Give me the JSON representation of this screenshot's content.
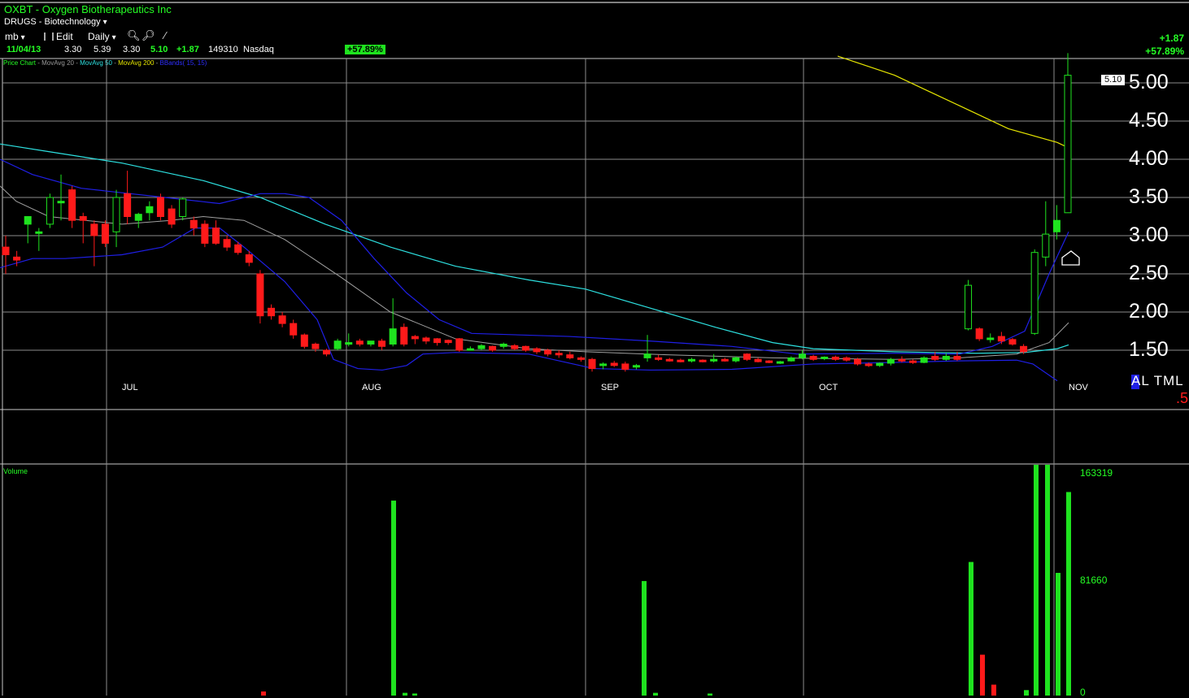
{
  "header": {
    "symbol_title": "OXBT - Oxygen Biotherapeutics Inc",
    "group": "DRUGS - Biotechnology",
    "menu": {
      "list": "mb",
      "edit": "Edit",
      "period": "Daily"
    }
  },
  "quote": {
    "date": "11/04/13",
    "open": "3.30",
    "high": "5.39",
    "low": "3.30",
    "close": "5.10",
    "change": "+1.87",
    "volume": "149310",
    "exchange": "Nasdaq",
    "pct_badge": "+57.89%"
  },
  "right_change": {
    "change": "+1.87",
    "pct": "+57.89%"
  },
  "legend": {
    "price": "Price Chart",
    "ma20": "MovAvg 20",
    "ma50": "MovAvg 50",
    "ma200": "MovAvg 200",
    "bb": "BBands( 15, 15)"
  },
  "price_tag": "5.10",
  "alert_text": "AL TML",
  "red_value": ".5",
  "volume_pane": {
    "label": "Volume",
    "ticks": [
      "163319",
      "81660",
      "0"
    ]
  },
  "colors": {
    "up": "#1fe31f",
    "down": "#ff1a1a",
    "ma20": "#a0a0a0",
    "ma50": "#2de0e0",
    "ma200": "#e6e600",
    "bb": "#1f1fe6"
  },
  "chart_data": {
    "type": "candlestick",
    "y_ticks": [
      "5.00",
      "4.50",
      "4.00",
      "3.50",
      "3.00",
      "2.50",
      "2.00",
      "1.50"
    ],
    "ylim": [
      1.15,
      5.35
    ],
    "x_months": [
      "JUL",
      "AUG",
      "SEP",
      "OCT",
      "NOV"
    ],
    "candles": [
      {
        "o": 2.85,
        "h": 3.0,
        "l": 2.5,
        "c": 2.75
      },
      {
        "o": 2.72,
        "h": 2.8,
        "l": 2.6,
        "c": 2.68
      },
      {
        "o": 3.15,
        "h": 3.2,
        "l": 2.9,
        "c": 3.25
      },
      {
        "o": 3.05,
        "h": 3.1,
        "l": 2.8,
        "c": 3.05
      },
      {
        "o": 3.15,
        "h": 3.55,
        "l": 3.1,
        "c": 3.5
      },
      {
        "o": 3.45,
        "h": 3.8,
        "l": 3.2,
        "c": 3.45
      },
      {
        "o": 3.6,
        "h": 3.65,
        "l": 3.1,
        "c": 3.2
      },
      {
        "o": 3.25,
        "h": 3.3,
        "l": 2.9,
        "c": 3.2
      },
      {
        "o": 3.15,
        "h": 3.2,
        "l": 2.6,
        "c": 3.0
      },
      {
        "o": 3.15,
        "h": 3.2,
        "l": 2.85,
        "c": 2.9
      },
      {
        "o": 3.05,
        "h": 3.6,
        "l": 2.85,
        "c": 3.5
      },
      {
        "o": 3.55,
        "h": 3.85,
        "l": 3.15,
        "c": 3.25
      },
      {
        "o": 3.2,
        "h": 3.3,
        "l": 3.1,
        "c": 3.28
      },
      {
        "o": 3.3,
        "h": 3.45,
        "l": 3.2,
        "c": 3.38
      },
      {
        "o": 3.5,
        "h": 3.55,
        "l": 3.2,
        "c": 3.25
      },
      {
        "o": 3.35,
        "h": 3.4,
        "l": 3.1,
        "c": 3.15
      },
      {
        "o": 3.25,
        "h": 3.5,
        "l": 3.2,
        "c": 3.48
      },
      {
        "o": 3.2,
        "h": 3.25,
        "l": 3.0,
        "c": 3.1
      },
      {
        "o": 3.15,
        "h": 3.2,
        "l": 2.85,
        "c": 2.9
      },
      {
        "o": 3.1,
        "h": 3.2,
        "l": 2.88,
        "c": 2.9
      },
      {
        "o": 2.95,
        "h": 3.0,
        "l": 2.8,
        "c": 2.85
      },
      {
        "o": 2.88,
        "h": 2.92,
        "l": 2.75,
        "c": 2.78
      },
      {
        "o": 2.75,
        "h": 2.8,
        "l": 2.6,
        "c": 2.65
      },
      {
        "o": 2.5,
        "h": 2.55,
        "l": 1.85,
        "c": 1.95
      },
      {
        "o": 2.05,
        "h": 2.1,
        "l": 1.9,
        "c": 1.95
      },
      {
        "o": 1.95,
        "h": 2.0,
        "l": 1.8,
        "c": 1.85
      },
      {
        "o": 1.85,
        "h": 1.9,
        "l": 1.65,
        "c": 1.7
      },
      {
        "o": 1.7,
        "h": 1.72,
        "l": 1.52,
        "c": 1.55
      },
      {
        "o": 1.58,
        "h": 1.6,
        "l": 1.48,
        "c": 1.52
      },
      {
        "o": 1.5,
        "h": 1.52,
        "l": 1.42,
        "c": 1.45
      },
      {
        "o": 1.52,
        "h": 1.65,
        "l": 1.5,
        "c": 1.62
      },
      {
        "o": 1.58,
        "h": 1.72,
        "l": 1.55,
        "c": 1.6
      },
      {
        "o": 1.62,
        "h": 1.65,
        "l": 1.55,
        "c": 1.58
      },
      {
        "o": 1.58,
        "h": 1.62,
        "l": 1.55,
        "c": 1.62
      },
      {
        "o": 1.62,
        "h": 1.65,
        "l": 1.5,
        "c": 1.55
      },
      {
        "o": 1.58,
        "h": 2.18,
        "l": 1.55,
        "c": 1.78
      },
      {
        "o": 1.8,
        "h": 1.85,
        "l": 1.55,
        "c": 1.58
      },
      {
        "o": 1.68,
        "h": 1.7,
        "l": 1.58,
        "c": 1.65
      },
      {
        "o": 1.66,
        "h": 1.68,
        "l": 1.58,
        "c": 1.62
      },
      {
        "o": 1.65,
        "h": 1.66,
        "l": 1.56,
        "c": 1.6
      },
      {
        "o": 1.63,
        "h": 1.64,
        "l": 1.57,
        "c": 1.6
      },
      {
        "o": 1.65,
        "h": 1.66,
        "l": 1.48,
        "c": 1.5
      },
      {
        "o": 1.52,
        "h": 1.55,
        "l": 1.5,
        "c": 1.52
      },
      {
        "o": 1.52,
        "h": 1.58,
        "l": 1.5,
        "c": 1.56
      },
      {
        "o": 1.55,
        "h": 1.56,
        "l": 1.48,
        "c": 1.5
      },
      {
        "o": 1.55,
        "h": 1.6,
        "l": 1.52,
        "c": 1.58
      },
      {
        "o": 1.56,
        "h": 1.58,
        "l": 1.5,
        "c": 1.52
      },
      {
        "o": 1.55,
        "h": 1.56,
        "l": 1.48,
        "c": 1.5
      },
      {
        "o": 1.52,
        "h": 1.54,
        "l": 1.45,
        "c": 1.48
      },
      {
        "o": 1.5,
        "h": 1.52,
        "l": 1.42,
        "c": 1.45
      },
      {
        "o": 1.46,
        "h": 1.5,
        "l": 1.4,
        "c": 1.45
      },
      {
        "o": 1.44,
        "h": 1.48,
        "l": 1.38,
        "c": 1.4
      },
      {
        "o": 1.4,
        "h": 1.42,
        "l": 1.35,
        "c": 1.38
      },
      {
        "o": 1.38,
        "h": 1.4,
        "l": 1.22,
        "c": 1.26
      },
      {
        "o": 1.3,
        "h": 1.34,
        "l": 1.25,
        "c": 1.32
      },
      {
        "o": 1.33,
        "h": 1.36,
        "l": 1.28,
        "c": 1.3
      },
      {
        "o": 1.32,
        "h": 1.35,
        "l": 1.22,
        "c": 1.25
      },
      {
        "o": 1.28,
        "h": 1.32,
        "l": 1.25,
        "c": 1.3
      },
      {
        "o": 1.4,
        "h": 1.7,
        "l": 1.35,
        "c": 1.45
      },
      {
        "o": 1.4,
        "h": 1.44,
        "l": 1.36,
        "c": 1.38
      },
      {
        "o": 1.38,
        "h": 1.4,
        "l": 1.35,
        "c": 1.37
      },
      {
        "o": 1.37,
        "h": 1.39,
        "l": 1.34,
        "c": 1.36
      },
      {
        "o": 1.36,
        "h": 1.4,
        "l": 1.34,
        "c": 1.38
      },
      {
        "o": 1.37,
        "h": 1.38,
        "l": 1.34,
        "c": 1.36
      },
      {
        "o": 1.36,
        "h": 1.45,
        "l": 1.34,
        "c": 1.38
      },
      {
        "o": 1.38,
        "h": 1.4,
        "l": 1.35,
        "c": 1.36
      },
      {
        "o": 1.36,
        "h": 1.42,
        "l": 1.34,
        "c": 1.4
      },
      {
        "o": 1.45,
        "h": 1.46,
        "l": 1.36,
        "c": 1.38
      },
      {
        "o": 1.38,
        "h": 1.4,
        "l": 1.34,
        "c": 1.35
      },
      {
        "o": 1.36,
        "h": 1.37,
        "l": 1.33,
        "c": 1.34
      },
      {
        "o": 1.34,
        "h": 1.36,
        "l": 1.32,
        "c": 1.35
      },
      {
        "o": 1.36,
        "h": 1.42,
        "l": 1.35,
        "c": 1.4
      },
      {
        "o": 1.4,
        "h": 1.5,
        "l": 1.38,
        "c": 1.45
      },
      {
        "o": 1.42,
        "h": 1.44,
        "l": 1.36,
        "c": 1.38
      },
      {
        "o": 1.4,
        "h": 1.42,
        "l": 1.37,
        "c": 1.41
      },
      {
        "o": 1.41,
        "h": 1.43,
        "l": 1.36,
        "c": 1.38
      },
      {
        "o": 1.4,
        "h": 1.42,
        "l": 1.35,
        "c": 1.37
      },
      {
        "o": 1.38,
        "h": 1.4,
        "l": 1.3,
        "c": 1.32
      },
      {
        "o": 1.32,
        "h": 1.34,
        "l": 1.28,
        "c": 1.3
      },
      {
        "o": 1.3,
        "h": 1.34,
        "l": 1.28,
        "c": 1.33
      },
      {
        "o": 1.33,
        "h": 1.4,
        "l": 1.3,
        "c": 1.38
      },
      {
        "o": 1.38,
        "h": 1.42,
        "l": 1.34,
        "c": 1.36
      },
      {
        "o": 1.36,
        "h": 1.38,
        "l": 1.32,
        "c": 1.34
      },
      {
        "o": 1.34,
        "h": 1.42,
        "l": 1.33,
        "c": 1.4
      },
      {
        "o": 1.42,
        "h": 1.48,
        "l": 1.36,
        "c": 1.38
      },
      {
        "o": 1.38,
        "h": 1.46,
        "l": 1.36,
        "c": 1.42
      },
      {
        "o": 1.42,
        "h": 1.48,
        "l": 1.36,
        "c": 1.38
      },
      {
        "o": 1.78,
        "h": 2.42,
        "l": 1.76,
        "c": 2.35
      },
      {
        "o": 1.78,
        "h": 1.8,
        "l": 1.62,
        "c": 1.65
      },
      {
        "o": 1.65,
        "h": 1.72,
        "l": 1.6,
        "c": 1.66
      },
      {
        "o": 1.68,
        "h": 1.74,
        "l": 1.58,
        "c": 1.62
      },
      {
        "o": 1.64,
        "h": 1.66,
        "l": 1.56,
        "c": 1.58
      },
      {
        "o": 1.55,
        "h": 1.58,
        "l": 1.45,
        "c": 1.48
      },
      {
        "o": 1.72,
        "h": 2.82,
        "l": 1.7,
        "c": 2.78
      },
      {
        "o": 2.72,
        "h": 3.45,
        "l": 2.6,
        "c": 3.02
      },
      {
        "o": 3.05,
        "h": 3.4,
        "l": 2.95,
        "c": 3.2
      },
      {
        "o": 3.3,
        "h": 5.39,
        "l": 3.3,
        "c": 5.1
      }
    ],
    "ma20": [
      [
        0,
        3.65
      ],
      [
        20,
        3.45
      ],
      [
        60,
        3.25
      ],
      [
        150,
        3.15
      ],
      [
        210,
        3.2
      ],
      [
        250,
        3.25
      ],
      [
        300,
        3.2
      ],
      [
        350,
        2.95
      ],
      [
        420,
        2.45
      ],
      [
        480,
        2.0
      ],
      [
        560,
        1.65
      ],
      [
        650,
        1.52
      ],
      [
        720,
        1.48
      ],
      [
        820,
        1.44
      ],
      [
        950,
        1.4
      ],
      [
        1100,
        1.38
      ],
      [
        1180,
        1.4
      ],
      [
        1250,
        1.45
      ],
      [
        1290,
        1.6
      ],
      [
        1314,
        1.86
      ]
    ],
    "ma50": [
      [
        0,
        4.2
      ],
      [
        60,
        4.1
      ],
      [
        150,
        3.95
      ],
      [
        250,
        3.72
      ],
      [
        320,
        3.5
      ],
      [
        400,
        3.15
      ],
      [
        480,
        2.85
      ],
      [
        560,
        2.6
      ],
      [
        650,
        2.42
      ],
      [
        720,
        2.3
      ],
      [
        800,
        2.05
      ],
      [
        880,
        1.8
      ],
      [
        950,
        1.6
      ],
      [
        1000,
        1.52
      ],
      [
        1100,
        1.48
      ],
      [
        1200,
        1.46
      ],
      [
        1260,
        1.47
      ],
      [
        1300,
        1.52
      ],
      [
        1314,
        1.57
      ]
    ],
    "ma200": [
      [
        1030,
        5.35
      ],
      [
        1100,
        5.1
      ],
      [
        1180,
        4.7
      ],
      [
        1240,
        4.4
      ],
      [
        1300,
        4.22
      ],
      [
        1314,
        4.15
      ]
    ],
    "bb_upper": [
      [
        0,
        4.0
      ],
      [
        40,
        3.8
      ],
      [
        100,
        3.62
      ],
      [
        160,
        3.55
      ],
      [
        220,
        3.48
      ],
      [
        270,
        3.42
      ],
      [
        320,
        3.55
      ],
      [
        350,
        3.55
      ],
      [
        380,
        3.5
      ],
      [
        420,
        3.2
      ],
      [
        460,
        2.7
      ],
      [
        500,
        2.25
      ],
      [
        540,
        1.9
      ],
      [
        580,
        1.72
      ],
      [
        700,
        1.68
      ],
      [
        800,
        1.62
      ],
      [
        900,
        1.55
      ],
      [
        980,
        1.45
      ],
      [
        1100,
        1.46
      ],
      [
        1180,
        1.45
      ],
      [
        1220,
        1.55
      ],
      [
        1260,
        1.75
      ],
      [
        1290,
        2.5
      ],
      [
        1314,
        3.05
      ]
    ],
    "bb_lower": [
      [
        0,
        2.58
      ],
      [
        40,
        2.7
      ],
      [
        80,
        2.7
      ],
      [
        150,
        2.75
      ],
      [
        200,
        2.85
      ],
      [
        240,
        3.1
      ],
      [
        270,
        3.1
      ],
      [
        300,
        2.85
      ],
      [
        350,
        2.4
      ],
      [
        390,
        1.9
      ],
      [
        410,
        1.38
      ],
      [
        440,
        1.26
      ],
      [
        470,
        1.24
      ],
      [
        500,
        1.3
      ],
      [
        520,
        1.45
      ],
      [
        560,
        1.47
      ],
      [
        650,
        1.45
      ],
      [
        730,
        1.26
      ],
      [
        800,
        1.24
      ],
      [
        900,
        1.25
      ],
      [
        1000,
        1.32
      ],
      [
        1100,
        1.34
      ],
      [
        1180,
        1.36
      ],
      [
        1250,
        1.37
      ],
      [
        1270,
        1.32
      ],
      [
        1300,
        1.1
      ]
    ]
  },
  "volume_data": {
    "ymax": 163319,
    "bars": [
      {
        "x": 484,
        "v": 143000
      },
      {
        "x": 324,
        "v": 3000
      },
      {
        "x": 498,
        "v": 2000
      },
      {
        "x": 510,
        "v": 1500
      },
      {
        "x": 792,
        "v": 84000
      },
      {
        "x": 806,
        "v": 2000
      },
      {
        "x": 873,
        "v": 1500
      },
      {
        "x": 1194,
        "v": 98000
      },
      {
        "x": 1208,
        "v": 30000
      },
      {
        "x": 1222,
        "v": 8000
      },
      {
        "x": 1262,
        "v": 4000
      },
      {
        "x": 1274,
        "v": 183000
      },
      {
        "x": 1288,
        "v": 183000
      },
      {
        "x": 1301,
        "v": 90000
      },
      {
        "x": 1314,
        "v": 149310
      }
    ]
  }
}
